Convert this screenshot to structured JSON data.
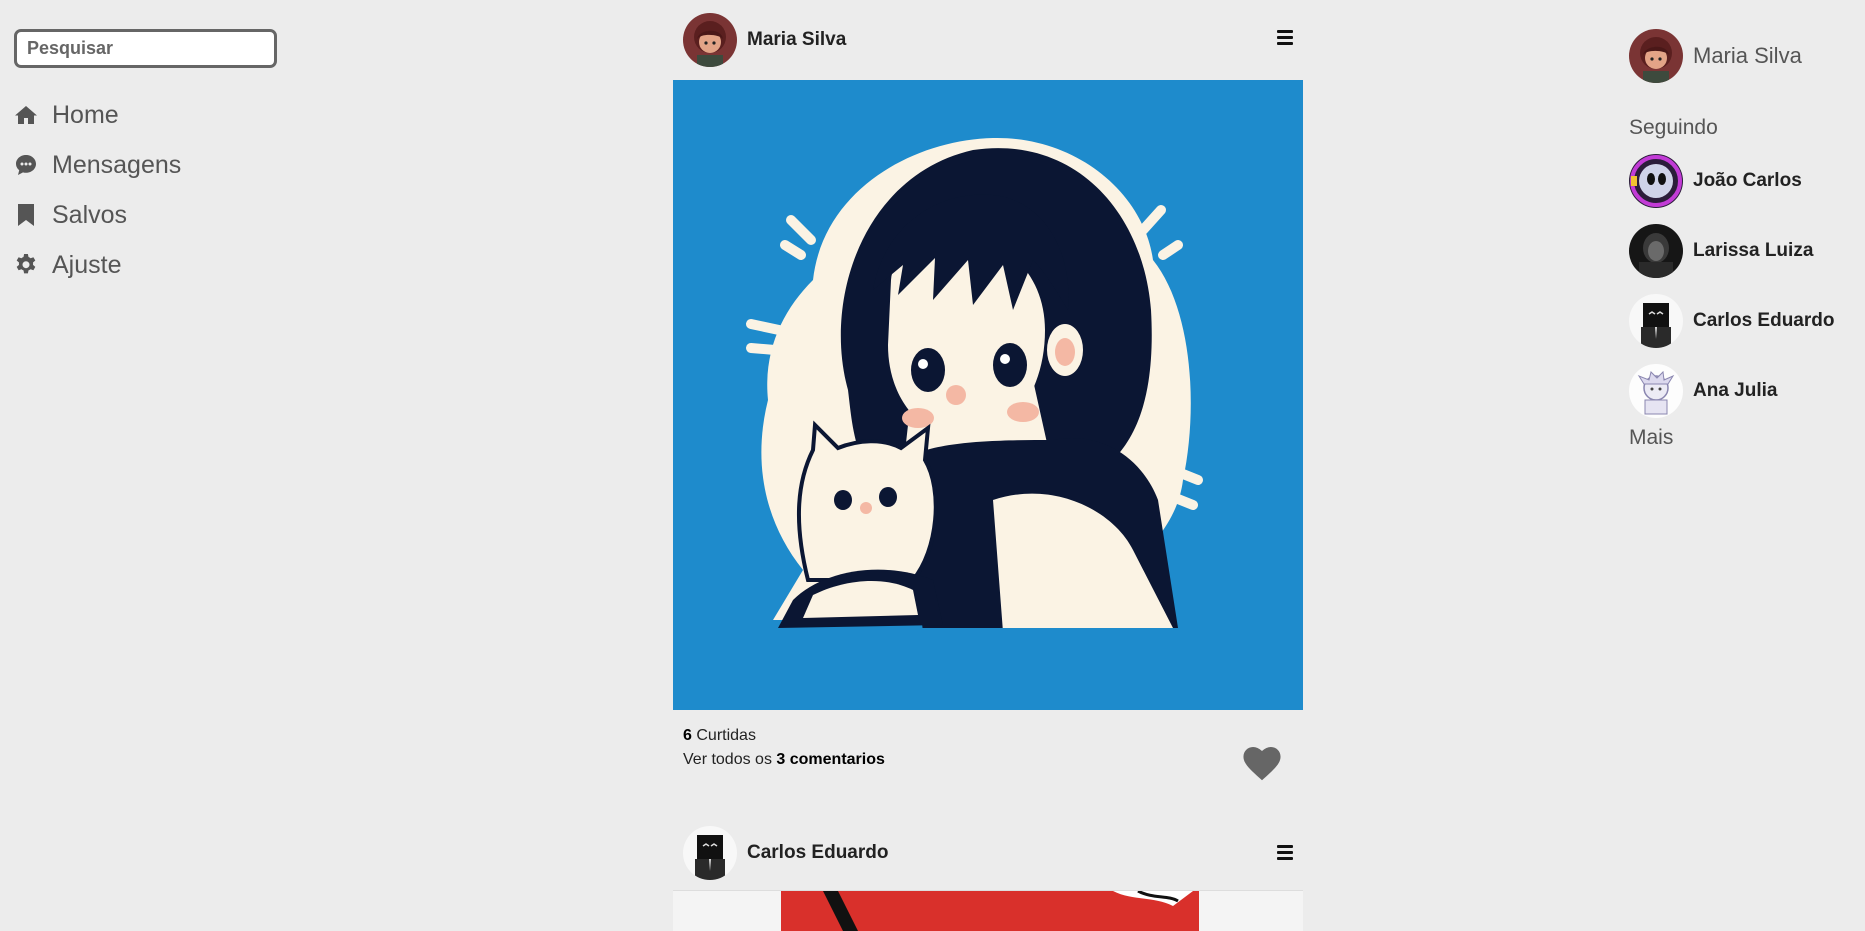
{
  "search": {
    "placeholder": "Pesquisar"
  },
  "nav": {
    "items": [
      {
        "label": "Home",
        "icon": "home-icon"
      },
      {
        "label": "Mensagens",
        "icon": "chat-bubble-icon"
      },
      {
        "label": "Salvos",
        "icon": "bookmark-icon"
      },
      {
        "label": "Ajuste",
        "icon": "gear-icon"
      }
    ]
  },
  "feed": {
    "posts": [
      {
        "author": "Maria Silva",
        "image": "illustration-girl-hugging-white-cat",
        "likes_count": "6",
        "likes_label": "Curtidas",
        "comments_prefix": "Ver todos os",
        "comments_count_text": "3 comentarios"
      },
      {
        "author": "Carlos Eduardo",
        "image": "red-illustration"
      }
    ]
  },
  "right": {
    "user_name": "Maria Silva",
    "following_title": "Seguindo",
    "following": [
      {
        "name": "João Carlos"
      },
      {
        "name": "Larissa Luiza"
      },
      {
        "name": "Carlos Eduardo"
      },
      {
        "name": "Ana Julia"
      }
    ],
    "more_label": "Mais"
  },
  "colors": {
    "background": "#ececec",
    "text": "#555555",
    "image_blue": "#1e8bcc",
    "heart": "#666666"
  }
}
